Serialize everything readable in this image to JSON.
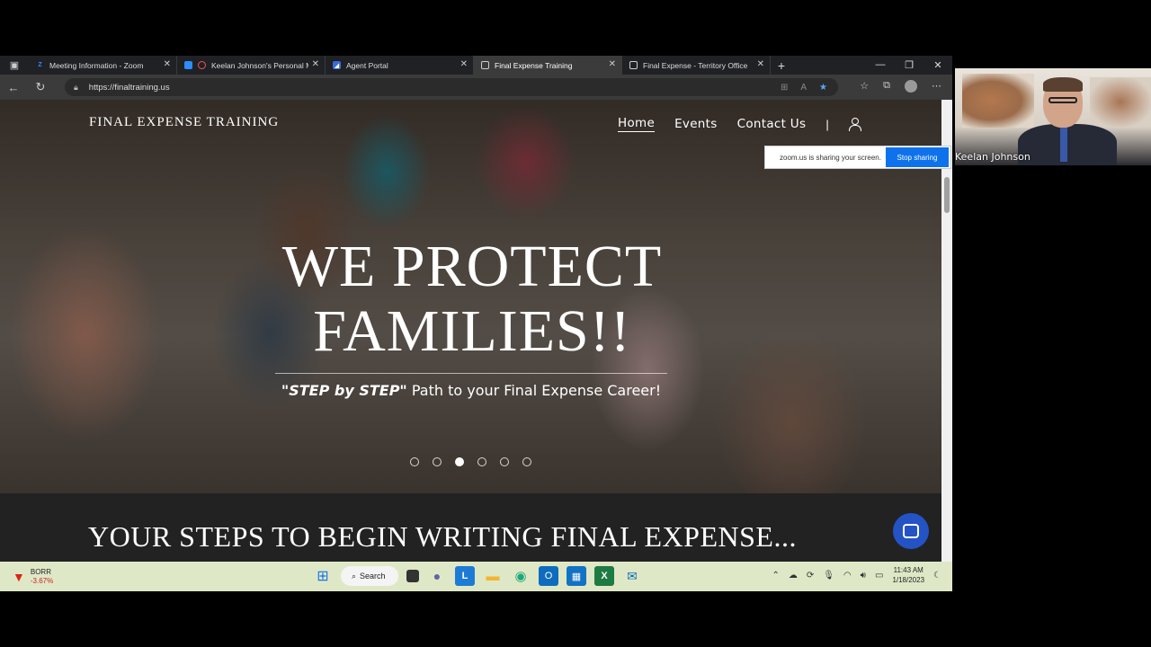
{
  "browser": {
    "tabs": [
      {
        "label": "Meeting Information - Zoom",
        "icon": "zoom-icon",
        "color": "#2d8cff"
      },
      {
        "label": "Keelan Johnson's Personal M",
        "icon": "record-icon",
        "color": "#e55"
      },
      {
        "label": "Agent Portal",
        "icon": "portal-icon",
        "color": "#3b6bd8"
      },
      {
        "label": "Final Expense Training",
        "icon": "page-icon",
        "color": "#ccc"
      },
      {
        "label": "Final Expense - Territory Office",
        "icon": "page-icon",
        "color": "#ccc"
      }
    ],
    "active_tab": 3,
    "url": "https://finaltraining.us"
  },
  "site": {
    "logo": "FINAL EXPENSE TRAINING",
    "nav": {
      "home": "Home",
      "events": "Events",
      "contact": "Contact Us",
      "sep": "|"
    },
    "hero": {
      "title_line1": "WE PROTECT",
      "title_line2": "FAMILIES!!",
      "sub_bold": "\"STEP by STEP\"",
      "sub_rest": " Path to your Final Expense Career!"
    },
    "slides": 6,
    "active_slide": 2,
    "steps_heading": "YOUR STEPS TO BEGIN WRITING FINAL EXPENSE..."
  },
  "share_banner": {
    "text": "zoom.us is sharing your screen.",
    "stop_label": "Stop sharing"
  },
  "taskbar": {
    "stock_symbol": "BORR",
    "stock_change": "-3.67%",
    "search_label": "Search",
    "time": "11:43 AM",
    "date": "1/18/2023"
  },
  "zoom": {
    "participant_name": "Keelan Johnson"
  }
}
